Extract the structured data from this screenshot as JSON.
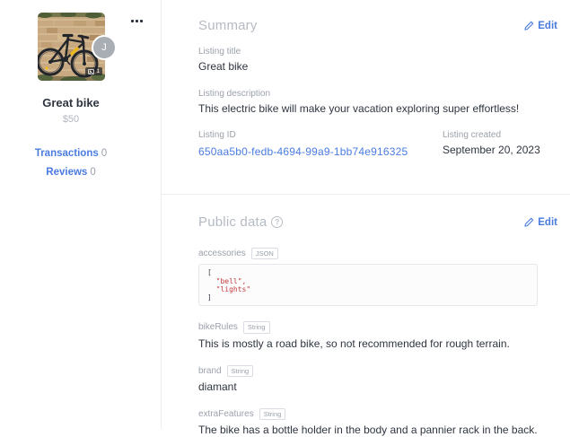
{
  "colors": {
    "accent_blue": "#4a7ce0",
    "code_string_red": "#c23b3b"
  },
  "sidebar": {
    "avatar_letter": "J",
    "image_count": "1",
    "listing_title": "Great bike",
    "listing_price": "$50",
    "transactions_label": "Transactions",
    "transactions_count": "0",
    "reviews_label": "Reviews",
    "reviews_count": "0"
  },
  "summary": {
    "heading": "Summary",
    "edit_label": "Edit",
    "listing_title_label": "Listing title",
    "listing_title_value": "Great bike",
    "listing_description_label": "Listing description",
    "listing_description_value": "This electric bike will make your vacation exploring super effortless!",
    "listing_id_label": "Listing ID",
    "listing_id_value": "650aa5b0-fedb-4694-99a9-1bb74e916325",
    "listing_created_label": "Listing created",
    "listing_created_value": "September 20, 2023"
  },
  "public_data": {
    "heading": "Public data",
    "help_glyph": "?",
    "edit_label": "Edit",
    "accessories": {
      "name": "accessories",
      "type_badge": "JSON",
      "code": {
        "l0": "[",
        "l1": "  \"bell\",",
        "l2": "  \"lights\"",
        "l3": "]"
      }
    },
    "bike_rules": {
      "name": "bikeRules",
      "type_badge": "String",
      "value": "This is mostly a road bike, so not recommended for rough terrain."
    },
    "brand": {
      "name": "brand",
      "type_badge": "String",
      "value": "diamant"
    },
    "extra_features": {
      "name": "extraFeatures",
      "type_badge": "String",
      "value": "The bike has a bottle holder in the body and a pannier rack in the back."
    }
  }
}
